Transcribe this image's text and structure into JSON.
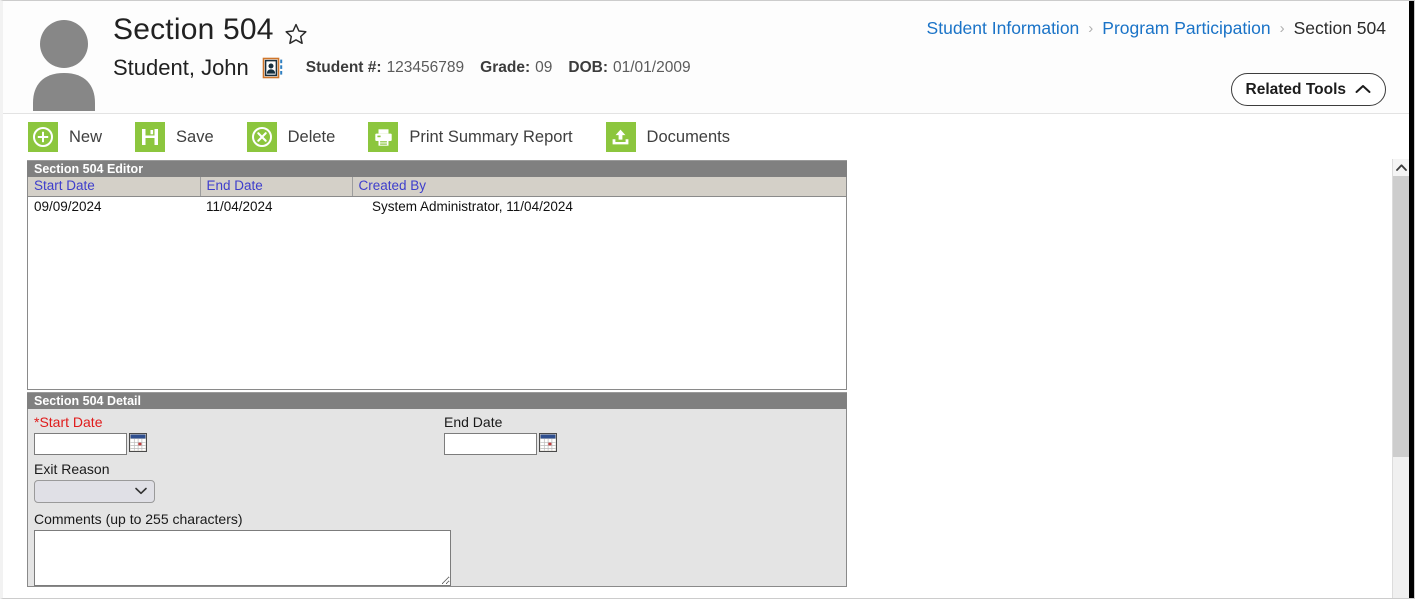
{
  "header": {
    "page_title": "Section 504",
    "favorite_icon": "star-outline-icon",
    "avatar_icon": "user-avatar-icon",
    "student_name": "Student, John",
    "contact_card_icon": "contact-card-icon",
    "meta": [
      {
        "label": "Student #:",
        "value": "123456789"
      },
      {
        "label": "Grade:",
        "value": "09"
      },
      {
        "label": "DOB:",
        "value": "01/01/2009"
      }
    ],
    "breadcrumb": {
      "items": [
        "Student Information",
        "Program Participation",
        "Section 504"
      ],
      "separator": "›"
    },
    "related_tools": {
      "label": "Related Tools",
      "chevron_icon": "chevron-up-icon"
    }
  },
  "toolbar": {
    "buttons": [
      {
        "label": "New",
        "icon": "plus-circle-icon"
      },
      {
        "label": "Save",
        "icon": "floppy-disk-icon"
      },
      {
        "label": "Delete",
        "icon": "x-circle-icon"
      },
      {
        "label": "Print Summary Report",
        "icon": "printer-icon"
      },
      {
        "label": "Documents",
        "icon": "upload-document-icon"
      }
    ],
    "icon_color": "#8cc63e"
  },
  "editor": {
    "title": "Section 504 Editor",
    "columns": [
      "Start Date",
      "End Date",
      "Created By"
    ],
    "rows": [
      {
        "start_date": "09/09/2024",
        "end_date": "11/04/2024",
        "created_by": "System Administrator, 11/04/2024"
      }
    ]
  },
  "detail": {
    "title": "Section 504 Detail",
    "start_date": {
      "label": "*Start Date",
      "value": "",
      "calendar_icon": "calendar-icon"
    },
    "end_date": {
      "label": "End Date",
      "value": "",
      "calendar_icon": "calendar-icon"
    },
    "exit_reason": {
      "label": "Exit Reason",
      "value": "",
      "options": [
        ""
      ],
      "chevron_icon": "chevron-down-icon"
    },
    "comments": {
      "label": "Comments (up to 255 characters)",
      "value": ""
    }
  },
  "scrollbar": {
    "up_arrow_icon": "chevron-up-icon"
  },
  "colors": {
    "accent_green": "#8cc63e",
    "panel_header_gray": "#808080",
    "grid_header_gray": "#d4d0c8",
    "link_blue": "#1a73c7",
    "grid_link_blue": "#3e3ecc",
    "required_red": "#e01b1b"
  }
}
